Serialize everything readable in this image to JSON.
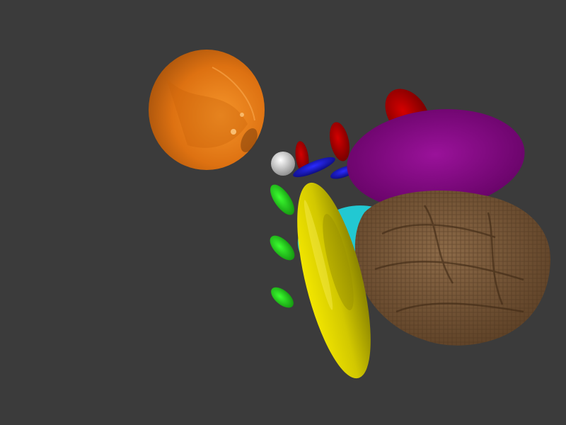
{
  "scene": {
    "background_color": "#3b3b3b",
    "objects": [
      {
        "name": "orange-translucent-sphere",
        "color": "#e8730c"
      },
      {
        "name": "white-small-sphere",
        "color": "#e6e6e6"
      },
      {
        "name": "red-ellipsoid",
        "color": "#b00000"
      },
      {
        "name": "blue-ellipsoid",
        "color": "#1010c8"
      },
      {
        "name": "green-ellipsoid",
        "color": "#22d21c"
      },
      {
        "name": "purple-disc",
        "color": "#8a008a"
      },
      {
        "name": "cyan-object",
        "color": "#22c8d2"
      },
      {
        "name": "yellow-disc",
        "color": "#d6cc00"
      },
      {
        "name": "brown-walnut-object",
        "color": "#7a5c3c"
      }
    ]
  }
}
